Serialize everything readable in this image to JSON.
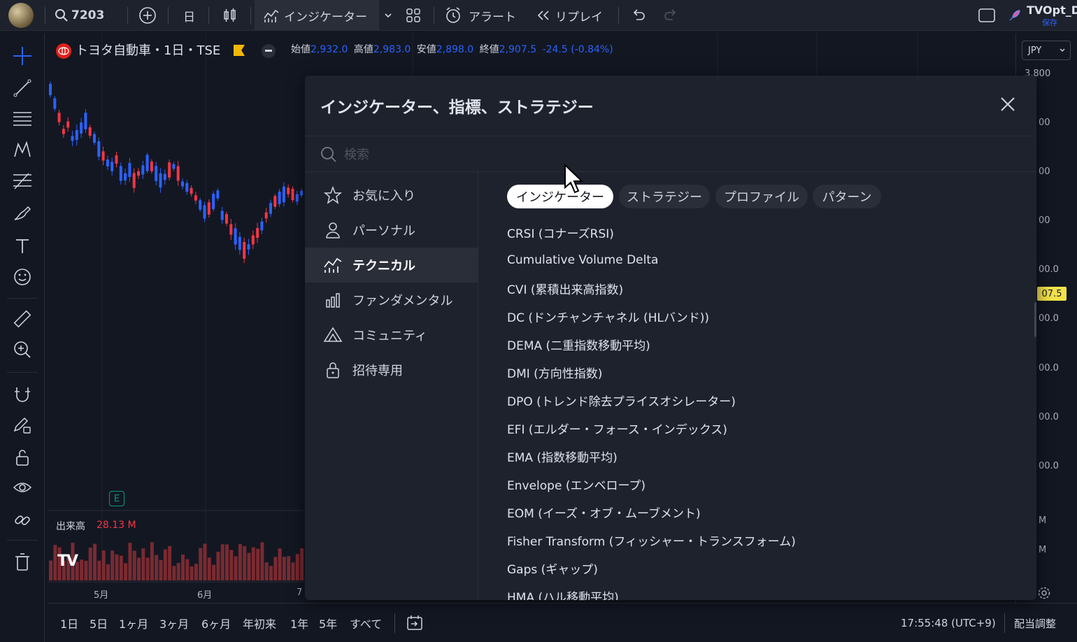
{
  "topbar": {
    "symbol": "7203",
    "interval": "日",
    "indicators_label": "インジケーター",
    "alert_label": "アラート",
    "replay_label": "リプレイ",
    "user_name": "TVOpt_D",
    "save_label": "保存"
  },
  "chart": {
    "symbol_title": "トヨタ自動車・1日・TSE",
    "open_label": "始値",
    "open_value": "2,932.0",
    "high_label": "高値",
    "high_value": "2,983.0",
    "low_label": "安値",
    "low_value": "2,898.0",
    "close_label": "終値",
    "close_value": "2,907.5",
    "change": "-24.5 (-0.84%)",
    "volume_label": "出来高",
    "volume_value": "28.13 M",
    "earnings_badge": "E",
    "time_labels": [
      "5月",
      "6月",
      "7"
    ],
    "colors": {
      "up": "#f23645",
      "down": "#2962ff",
      "volume": "#7a2a31"
    }
  },
  "price_axis": {
    "currency": "JPY",
    "labels": [
      "3,800",
      "00",
      "00",
      "00",
      "00.0",
      "00.0",
      "00.0",
      "00.0",
      "00.0",
      "M",
      "M"
    ],
    "current_price_tag": "07.5"
  },
  "bottombar": {
    "ranges": [
      "1日",
      "5日",
      "1ヶ月",
      "3ヶ月",
      "6ヶ月",
      "年初来",
      "1年",
      "5年",
      "すべて"
    ],
    "clock": "17:55:48 (UTC+9)",
    "adjust_label": "配当調整"
  },
  "dialog": {
    "title": "インジケーター、指標、ストラテジー",
    "search_placeholder": "検索",
    "sidebar": [
      {
        "label": "お気に入り",
        "icon": "star-icon"
      },
      {
        "label": "パーソナル",
        "icon": "user-icon"
      },
      {
        "label": "テクニカル",
        "icon": "technical-chart-icon",
        "active": true
      },
      {
        "label": "ファンダメンタル",
        "icon": "bar-chart-icon"
      },
      {
        "label": "コミュニティ",
        "icon": "community-icon"
      },
      {
        "label": "招待専用",
        "icon": "lock-icon"
      }
    ],
    "chips": [
      "インジケーター",
      "ストラテジー",
      "プロファイル",
      "パターン"
    ],
    "items": [
      "CRSI (コナーズRSI)",
      "Cumulative Volume Delta",
      "CVI (累積出来高指数)",
      "DC (ドンチャンチャネル (HLバンド))",
      "DEMA (二重指数移動平均)",
      "DMI (方向性指数)",
      "DPO (トレンド除去プライスオシレーター)",
      "EFI (エルダー・フォース・インデックス)",
      "EMA (指数移動平均)",
      "Envelope (エンベロープ)",
      "EOM (イーズ・オブ・ムーブメント)",
      "Fisher Transform (フィッシャー・トランスフォーム)",
      "Gaps (ギャップ)",
      "HMA (ハル移動平均)"
    ]
  }
}
